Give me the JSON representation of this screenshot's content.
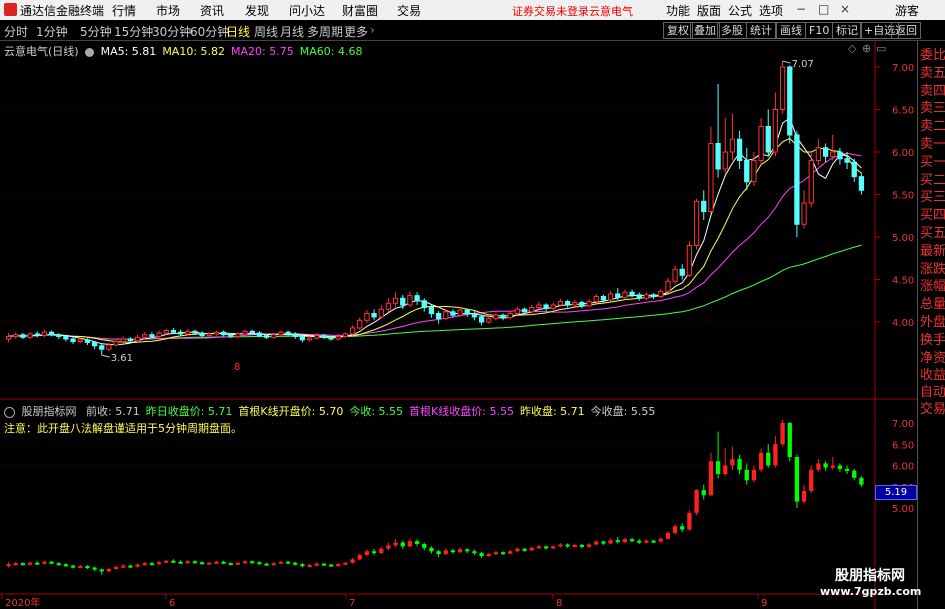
{
  "app": {
    "title": "通达信金融终端"
  },
  "menu": {
    "items": [
      "行情",
      "市场",
      "资讯",
      "发现",
      "问小达",
      "财富圈",
      "交易"
    ],
    "notice": "证券交易未登录",
    "stock": "云意电气",
    "right_items": [
      "功能",
      "版面",
      "公式",
      "选项"
    ],
    "user": "游客"
  },
  "periods": {
    "items": [
      "分时",
      "1分钟",
      "5分钟",
      "15分钟",
      "30分钟",
      "60分钟",
      "日线",
      "周线",
      "月线",
      "多周期",
      "更多"
    ],
    "active": "日线"
  },
  "right_buttons": [
    "复权",
    "叠加",
    "多股",
    "统计",
    "画线",
    "F10",
    "标记",
    "+自选",
    "返回"
  ],
  "side_panel": {
    "items": [
      "委比",
      "卖五",
      "卖四",
      "卖三",
      "卖二",
      "卖一",
      "买一",
      "买二",
      "买三",
      "买四",
      "买五",
      "最新",
      "涨跌",
      "涨幅",
      "总量",
      "外盘",
      "换手",
      "净资",
      "收益"
    ],
    "lower": [
      "自动",
      "交易"
    ]
  },
  "main_chart": {
    "title": "云意电气(日线)",
    "ma": [
      {
        "label": "MA5",
        "value": "5.81",
        "color": "#ffffff"
      },
      {
        "label": "MA10",
        "value": "5.82",
        "color": "#ffff55"
      },
      {
        "label": "MA20",
        "value": "5.75",
        "color": "#ff44ff"
      },
      {
        "label": "MA60",
        "value": "4.68",
        "color": "#44ff44"
      }
    ],
    "high_label": "7.07",
    "low_label": "3.61",
    "marker": "8"
  },
  "sub_chart": {
    "title": "股朋指标网",
    "fields": [
      {
        "label": "前收",
        "value": "5.71",
        "color": "#cccccc"
      },
      {
        "label": "昨日收盘价",
        "value": "5.71",
        "color": "#44ff44"
      },
      {
        "label": "首根K线开盘价",
        "value": "5.70",
        "color": "#ffff55"
      },
      {
        "label": "今收",
        "value": "5.55",
        "color": "#44ff44"
      },
      {
        "label": "首根K线收盘价",
        "value": "5.55",
        "color": "#ff44ff"
      },
      {
        "label": "昨收盘",
        "value": "5.71",
        "color": "#ffff55"
      },
      {
        "label": "今收盘",
        "value": "5.55",
        "color": "#cccccc"
      }
    ],
    "note": "注意：此开盘八法解盘谨适用于5分钟周期盘面。",
    "current_tag": "5.19"
  },
  "axis": {
    "main_ticks": [
      "7.00",
      "6.50",
      "6.00",
      "5.50",
      "5.00",
      "4.50",
      "4.00"
    ],
    "sub_ticks": [
      "7.00",
      "6.50",
      "6.00",
      "5.50",
      "5.00"
    ],
    "dates": [
      "2020年",
      "6",
      "7",
      "8",
      "9"
    ]
  },
  "chart_data": {
    "type": "candlestick",
    "ylim": [
      3.45,
      7.15
    ],
    "candles": [
      [
        3.8,
        3.83,
        3.76,
        3.87
      ],
      [
        3.83,
        3.85,
        3.8,
        3.88
      ],
      [
        3.85,
        3.82,
        3.8,
        3.87
      ],
      [
        3.82,
        3.86,
        3.8,
        3.88
      ],
      [
        3.86,
        3.84,
        3.82,
        3.89
      ],
      [
        3.84,
        3.88,
        3.82,
        3.91
      ],
      [
        3.88,
        3.85,
        3.83,
        3.9
      ],
      [
        3.85,
        3.83,
        3.8,
        3.87
      ],
      [
        3.83,
        3.8,
        3.77,
        3.85
      ],
      [
        3.8,
        3.77,
        3.74,
        3.82
      ],
      [
        3.77,
        3.79,
        3.75,
        3.82
      ],
      [
        3.79,
        3.76,
        3.73,
        3.81
      ],
      [
        3.76,
        3.72,
        3.68,
        3.78
      ],
      [
        3.72,
        3.68,
        3.61,
        3.74
      ],
      [
        3.68,
        3.73,
        3.66,
        3.76
      ],
      [
        3.73,
        3.77,
        3.71,
        3.8
      ],
      [
        3.77,
        3.8,
        3.75,
        3.83
      ],
      [
        3.8,
        3.78,
        3.75,
        3.82
      ],
      [
        3.78,
        3.82,
        3.76,
        3.85
      ],
      [
        3.82,
        3.85,
        3.8,
        3.88
      ],
      [
        3.85,
        3.83,
        3.81,
        3.88
      ],
      [
        3.83,
        3.87,
        3.81,
        3.9
      ],
      [
        3.87,
        3.9,
        3.85,
        3.92
      ],
      [
        3.9,
        3.88,
        3.86,
        3.93
      ],
      [
        3.88,
        3.86,
        3.84,
        3.91
      ],
      [
        3.86,
        3.89,
        3.84,
        3.92
      ],
      [
        3.89,
        3.87,
        3.85,
        3.91
      ],
      [
        3.87,
        3.84,
        3.82,
        3.89
      ],
      [
        3.84,
        3.86,
        3.82,
        3.88
      ],
      [
        3.86,
        3.88,
        3.84,
        3.9
      ],
      [
        3.88,
        3.85,
        3.83,
        3.9
      ],
      [
        3.85,
        3.83,
        3.81,
        3.87
      ],
      [
        3.83,
        3.86,
        3.81,
        3.88
      ],
      [
        3.86,
        3.89,
        3.84,
        3.91
      ],
      [
        3.89,
        3.87,
        3.85,
        3.91
      ],
      [
        3.87,
        3.84,
        3.82,
        3.89
      ],
      [
        3.84,
        3.82,
        3.8,
        3.86
      ],
      [
        3.82,
        3.85,
        3.8,
        3.87
      ],
      [
        3.85,
        3.88,
        3.83,
        3.9
      ],
      [
        3.88,
        3.86,
        3.84,
        3.9
      ],
      [
        3.86,
        3.83,
        3.8,
        3.88
      ],
      [
        3.83,
        3.79,
        3.76,
        3.85
      ],
      [
        3.79,
        3.81,
        3.77,
        3.84
      ],
      [
        3.81,
        3.84,
        3.79,
        3.87
      ],
      [
        3.84,
        3.82,
        3.8,
        3.86
      ],
      [
        3.82,
        3.8,
        3.78,
        3.84
      ],
      [
        3.8,
        3.83,
        3.78,
        3.86
      ],
      [
        3.83,
        3.86,
        3.81,
        3.88
      ],
      [
        3.86,
        3.93,
        3.84,
        3.96
      ],
      [
        3.93,
        4.02,
        3.91,
        4.05
      ],
      [
        4.02,
        4.1,
        3.99,
        4.14
      ],
      [
        4.1,
        4.06,
        4.02,
        4.15
      ],
      [
        4.06,
        4.15,
        4.04,
        4.2
      ],
      [
        4.15,
        4.22,
        4.12,
        4.28
      ],
      [
        4.22,
        4.28,
        4.18,
        4.35
      ],
      [
        4.28,
        4.2,
        4.15,
        4.32
      ],
      [
        4.2,
        4.31,
        4.18,
        4.36
      ],
      [
        4.31,
        4.25,
        4.2,
        4.35
      ],
      [
        4.25,
        4.17,
        4.12,
        4.28
      ],
      [
        4.17,
        4.1,
        4.05,
        4.2
      ],
      [
        4.1,
        4.04,
        3.98,
        4.13
      ],
      [
        4.04,
        4.12,
        4.02,
        4.16
      ],
      [
        4.12,
        4.08,
        4.05,
        4.15
      ],
      [
        4.08,
        4.14,
        4.06,
        4.18
      ],
      [
        4.14,
        4.1,
        4.06,
        4.16
      ],
      [
        4.1,
        4.06,
        4.02,
        4.13
      ],
      [
        4.06,
        4.0,
        3.96,
        4.09
      ],
      [
        4.0,
        4.04,
        3.98,
        4.07
      ],
      [
        4.04,
        4.08,
        4.02,
        4.11
      ],
      [
        4.08,
        4.05,
        4.02,
        4.1
      ],
      [
        4.05,
        4.1,
        4.03,
        4.13
      ],
      [
        4.1,
        4.15,
        4.08,
        4.18
      ],
      [
        4.15,
        4.12,
        4.09,
        4.17
      ],
      [
        4.12,
        4.17,
        4.1,
        4.2
      ],
      [
        4.17,
        4.2,
        4.15,
        4.24
      ],
      [
        4.2,
        4.16,
        4.13,
        4.22
      ],
      [
        4.16,
        4.2,
        4.14,
        4.23
      ],
      [
        4.2,
        4.24,
        4.18,
        4.27
      ],
      [
        4.24,
        4.2,
        4.17,
        4.26
      ],
      [
        4.2,
        4.23,
        4.18,
        4.26
      ],
      [
        4.23,
        4.19,
        4.16,
        4.25
      ],
      [
        4.19,
        4.24,
        4.17,
        4.27
      ],
      [
        4.24,
        4.3,
        4.22,
        4.33
      ],
      [
        4.3,
        4.26,
        4.23,
        4.32
      ],
      [
        4.26,
        4.33,
        4.24,
        4.37
      ],
      [
        4.33,
        4.29,
        4.26,
        4.4
      ],
      [
        4.29,
        4.35,
        4.27,
        4.38
      ],
      [
        4.35,
        4.32,
        4.29,
        4.38
      ],
      [
        4.32,
        4.28,
        4.25,
        4.35
      ],
      [
        4.28,
        4.32,
        4.26,
        4.35
      ],
      [
        4.32,
        4.3,
        4.27,
        4.34
      ],
      [
        4.3,
        4.36,
        4.28,
        4.39
      ],
      [
        4.36,
        4.48,
        4.34,
        4.52
      ],
      [
        4.48,
        4.62,
        4.45,
        4.66
      ],
      [
        4.62,
        4.55,
        4.5,
        4.68
      ],
      [
        4.55,
        4.9,
        4.53,
        4.95
      ],
      [
        4.9,
        5.42,
        4.85,
        5.45
      ],
      [
        5.42,
        5.3,
        5.2,
        5.55
      ],
      [
        5.3,
        6.1,
        5.28,
        6.3
      ],
      [
        6.1,
        5.8,
        5.7,
        6.8
      ],
      [
        5.8,
        6.0,
        5.75,
        6.4
      ],
      [
        6.0,
        6.15,
        5.9,
        6.45
      ],
      [
        6.15,
        5.9,
        5.8,
        6.25
      ],
      [
        5.9,
        5.65,
        5.55,
        6.05
      ],
      [
        5.65,
        5.9,
        5.6,
        6.0
      ],
      [
        5.9,
        6.3,
        5.85,
        6.4
      ],
      [
        6.3,
        6.0,
        5.95,
        6.5
      ],
      [
        6.0,
        6.5,
        5.95,
        6.7
      ],
      [
        6.5,
        7.0,
        6.45,
        7.07
      ],
      [
        7.0,
        6.2,
        6.1,
        7.02
      ],
      [
        6.2,
        5.15,
        5.0,
        6.25
      ],
      [
        5.15,
        5.4,
        5.1,
        5.55
      ],
      [
        5.4,
        5.9,
        5.35,
        6.0
      ],
      [
        5.9,
        6.05,
        5.85,
        6.15
      ],
      [
        6.05,
        5.95,
        5.88,
        6.1
      ],
      [
        5.95,
        6.0,
        5.9,
        6.2
      ],
      [
        6.0,
        5.92,
        5.85,
        6.05
      ],
      [
        5.92,
        5.88,
        5.8,
        6.0
      ],
      [
        5.88,
        5.71,
        5.65,
        5.92
      ],
      [
        5.71,
        5.55,
        5.5,
        5.75
      ]
    ]
  },
  "colors": {
    "up": "#ff3232",
    "down": "#54ffff",
    "sub_up": "#ff2020",
    "sub_down": "#00ff00",
    "grid": "#7a0000"
  },
  "watermark": {
    "line1": "股朋指标网",
    "line2": "www.7gpzb.com"
  }
}
